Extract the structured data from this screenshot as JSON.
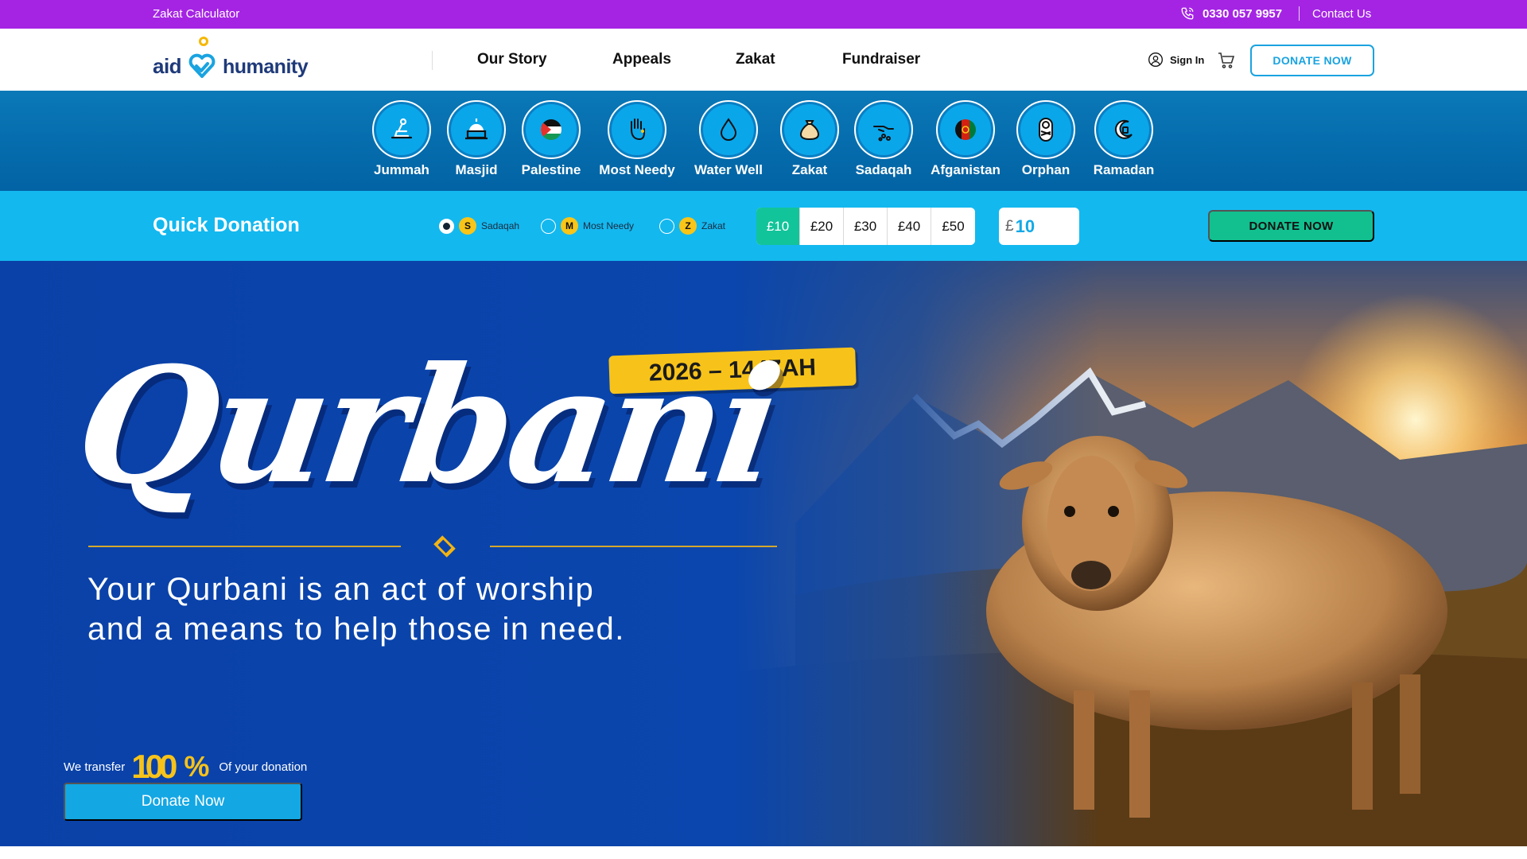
{
  "topbar": {
    "zakat_calculator": "Zakat Calculator",
    "phone": "0330 057 9957",
    "contact": "Contact Us"
  },
  "header": {
    "logo_aid": "aid",
    "logo_humanity": "humanity",
    "nav": [
      {
        "label": "Our Story"
      },
      {
        "label": "Appeals"
      },
      {
        "label": "Zakat"
      },
      {
        "label": "Fundraiser"
      }
    ],
    "sign_in": "Sign In",
    "donate_now": "DONATE NOW"
  },
  "categories": [
    {
      "label": "Jummah",
      "icon": "prayer-icon"
    },
    {
      "label": "Masjid",
      "icon": "mosque-icon"
    },
    {
      "label": "Palestine",
      "icon": "palestine-flag-icon"
    },
    {
      "label": "Most Needy",
      "icon": "hand-icon"
    },
    {
      "label": "Water Well",
      "icon": "water-drop-icon"
    },
    {
      "label": "Zakat",
      "icon": "money-bag-icon"
    },
    {
      "label": "Sadaqah",
      "icon": "giving-hand-icon"
    },
    {
      "label": "Afganistan",
      "icon": "afghanistan-flag-icon"
    },
    {
      "label": "Orphan",
      "icon": "baby-icon"
    },
    {
      "label": "Ramadan",
      "icon": "crescent-icon"
    }
  ],
  "quick_donation": {
    "title": "Quick Donation",
    "options": [
      {
        "badge": "S",
        "label": "Sadaqah",
        "selected": true
      },
      {
        "badge": "M",
        "label": "Most Needy",
        "selected": false
      },
      {
        "badge": "Z",
        "label": "Zakat",
        "selected": false
      }
    ],
    "amounts": [
      "£10",
      "£20",
      "£30",
      "£40",
      "£50"
    ],
    "selected_amount": "£10",
    "currency": "£",
    "custom_value": "10",
    "donate_now": "DONATE NOW",
    "colors": {
      "bar": "#13b8ef",
      "active": "#12c49a"
    }
  },
  "hero": {
    "year_tag": "2026 – 1447AH",
    "headline": "Qurbani",
    "tagline_line1": "Your Qurbani is an act of worship",
    "tagline_line2": "and a means to help those in need.",
    "transfer_prefix": "We transfer",
    "transfer_amount": "100",
    "transfer_percent": "%",
    "transfer_suffix": "Of your donation",
    "donate_button": "Donate Now"
  },
  "colors": {
    "topbar": "#a524e4",
    "brand_blue": "#1aa3e0",
    "category_strip": "#0263a4",
    "year_tag": "#f7c31a"
  }
}
